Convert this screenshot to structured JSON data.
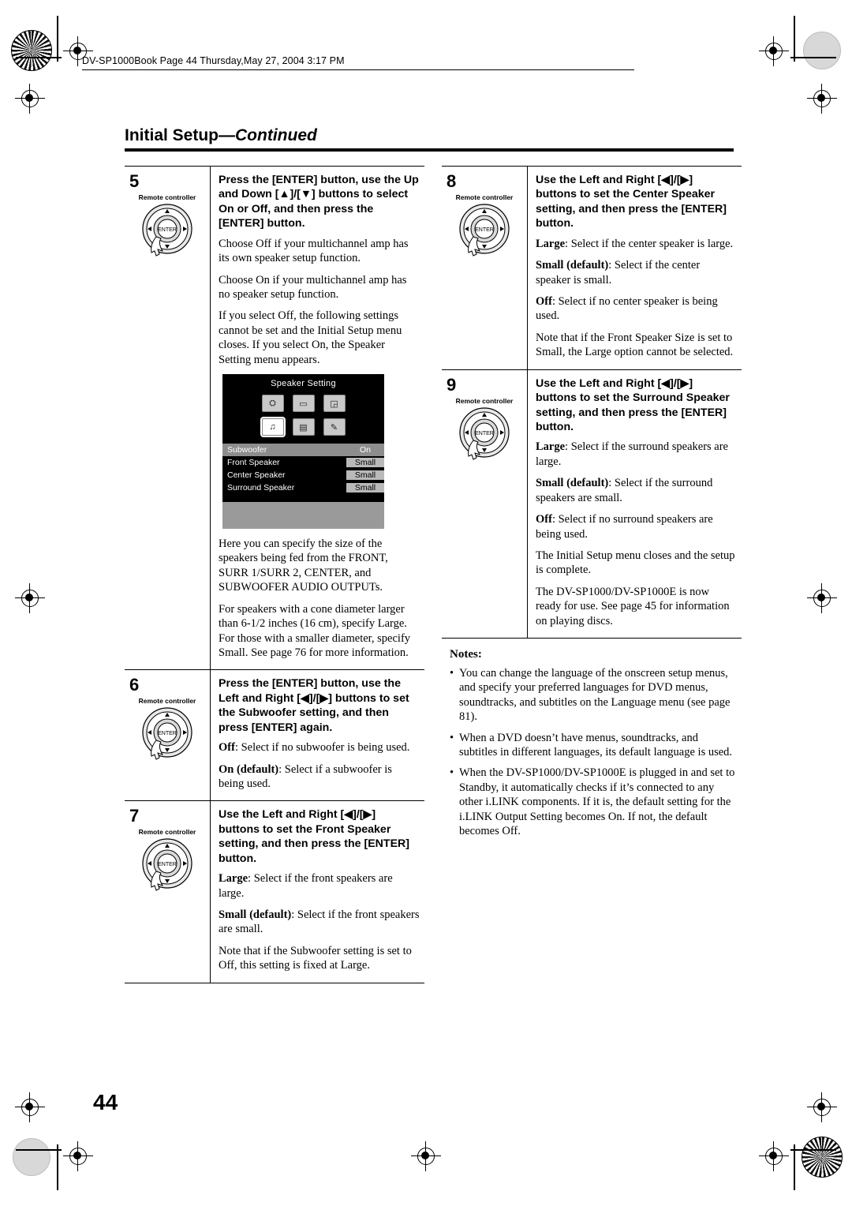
{
  "header": {
    "file_line": "DV-SP1000Book  Page 44  Thursday,May 27, 2004  3:17 PM"
  },
  "page": {
    "title_main": "Initial Setup",
    "title_cont": "—Continued",
    "number": "44"
  },
  "labels": {
    "remote_controller": "Remote controller",
    "enter": "ENTER"
  },
  "steps": [
    {
      "num": "5",
      "instruction": "Press the [ENTER] button, use the Up and Down [▲]/[▼] buttons to select On or Off, and then press the [ENTER] button.",
      "paragraphs": [
        "Choose Off if your multichannel amp has its own speaker setup function.",
        "Choose On if your multichannel amp has no speaker setup function.",
        "If you select Off, the following settings cannot be set and the Initial Setup menu closes. If you select On, the Speaker Setting menu appears."
      ],
      "after_image": [
        "Here you can specify the size of the speakers being fed from the FRONT, SURR 1/SURR 2, CENTER, and SUBWOOFER AUDIO OUTPUTs.",
        "For speakers with a cone diameter larger than 6-1/2 inches (16 cm), specify Large. For those with a smaller diameter, specify Small. See page 76 for more information."
      ]
    },
    {
      "num": "6",
      "instruction": "Press the [ENTER] button, use the Left and Right [◀]/[▶] buttons to set the Subwoofer setting, and then press [ENTER] again.",
      "paragraphs": [
        "Off: Select if no subwoofer is being used.",
        "On (default): Select if a subwoofer is being used."
      ]
    },
    {
      "num": "7",
      "instruction": "Use the Left and Right [◀]/[▶] buttons to set the Front Speaker setting, and then press the [ENTER] button.",
      "paragraphs": [
        "Large: Select if the front speakers are large.",
        "Small (default): Select if the front speakers are small.",
        "Note that if the Subwoofer setting is set to Off, this setting is fixed at Large."
      ]
    },
    {
      "num": "8",
      "instruction": "Use the Left and Right [◀]/[▶] buttons to set the Center Speaker setting, and then press the [ENTER] button.",
      "paragraphs": [
        "Large: Select if the center speaker is large.",
        "Small (default): Select if the center speaker is small.",
        "Off: Select if no center speaker is being used.",
        "Note that if the Front Speaker Size is set to Small, the Large option cannot be selected."
      ]
    },
    {
      "num": "9",
      "instruction": "Use the Left and Right [◀]/[▶] buttons to set the Surround Speaker setting, and then press the [ENTER] button.",
      "paragraphs": [
        "Large: Select if the surround speakers are large.",
        "Small (default): Select if the surround speakers are small.",
        "Off: Select if no surround speakers are being used.",
        "The Initial Setup menu closes and the setup is complete.",
        "The DV-SP1000/DV-SP1000E is now ready for use. See page 45 for information on playing discs."
      ]
    }
  ],
  "osd": {
    "title": "Speaker Setting",
    "rows": [
      {
        "label": "Subwoofer",
        "value": "On",
        "highlight": true
      },
      {
        "label": "Front Speaker",
        "value": "Small",
        "highlight": false
      },
      {
        "label": "Center Speaker",
        "value": "Small",
        "highlight": false
      },
      {
        "label": "Surround Speaker",
        "value": "Small",
        "highlight": false
      }
    ]
  },
  "notes": {
    "heading": "Notes:",
    "items": [
      "You can change the language of the onscreen setup menus, and specify your preferred languages for DVD menus, soundtracks, and subtitles on the Language menu (see page 81).",
      "When a DVD doesn’t have menus, soundtracks, and subtitles in different languages, its default language is used.",
      "When the DV-SP1000/DV-SP1000E is plugged in and set to Standby, it automatically checks if it’s connected to any other i.LINK components. If it is, the default setting for the i.LINK Output Setting becomes On. If not, the default becomes Off."
    ]
  }
}
